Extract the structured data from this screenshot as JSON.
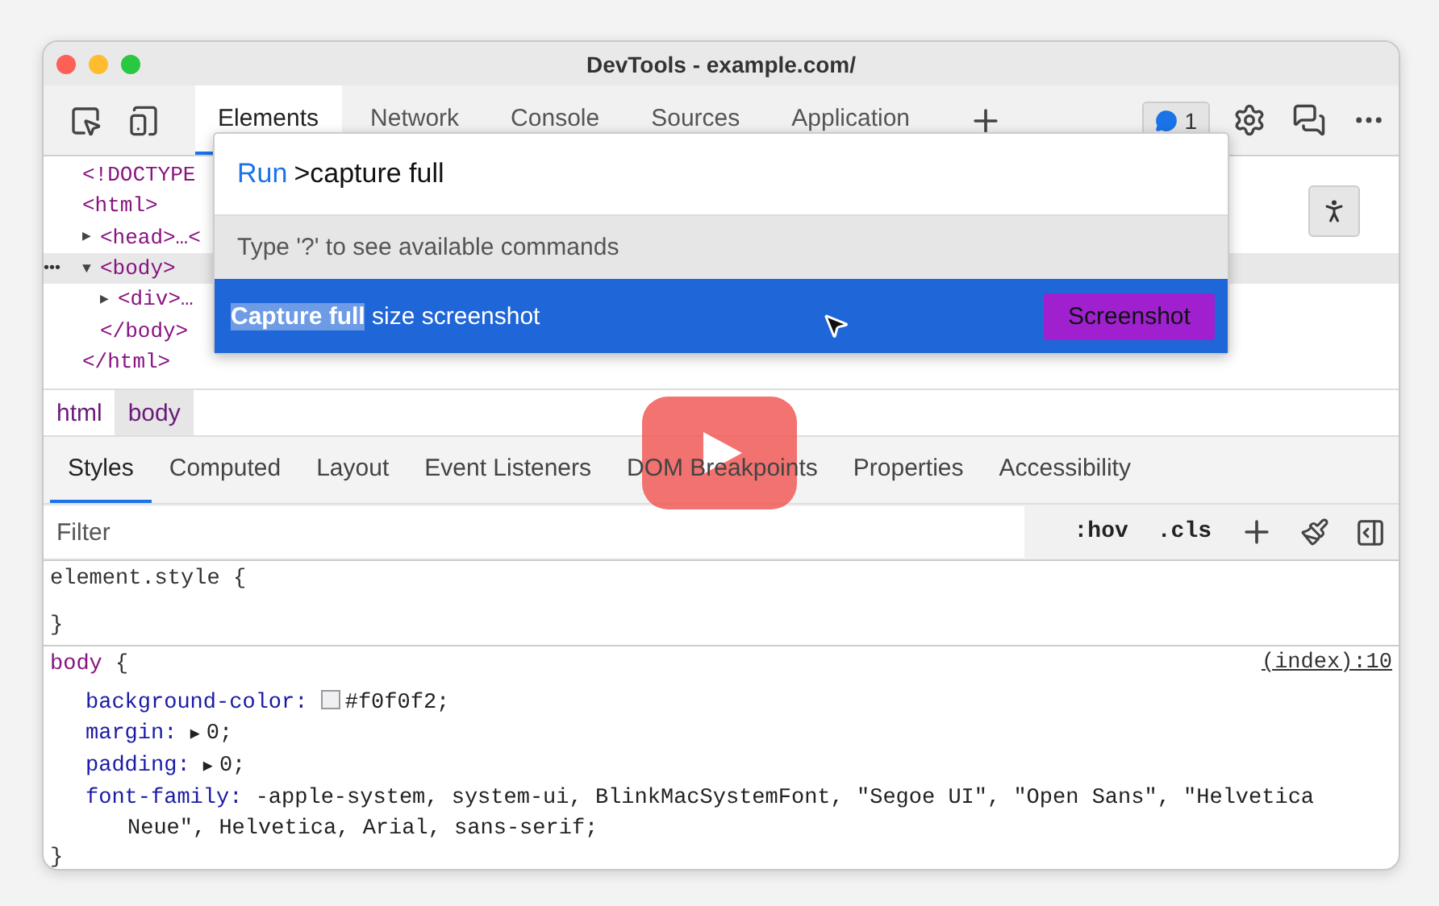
{
  "window": {
    "title": "DevTools - example.com/"
  },
  "toolbar": {
    "tabs": [
      {
        "label": "Elements",
        "selected": true
      },
      {
        "label": "Network",
        "selected": false
      },
      {
        "label": "Console",
        "selected": false
      },
      {
        "label": "Sources",
        "selected": false
      },
      {
        "label": "Application",
        "selected": false
      }
    ],
    "issues_count": "1"
  },
  "dom_tree": [
    {
      "text": "<!DOCTYPE",
      "selected": false
    },
    {
      "text": "<html>",
      "selected": false,
      "closing": "</html>",
      "children": [
        {
          "text": "<head>…<",
          "marker": "▶",
          "selected": false
        },
        {
          "text": "<body>",
          "marker": "▼",
          "selected": true,
          "dots": "•••",
          "closing": "</body>",
          "children": [
            {
              "text": "<div>…",
              "marker": "▶",
              "selected": false
            }
          ]
        }
      ]
    }
  ],
  "command_menu": {
    "prompt": "Run",
    "query": ">capture full",
    "hint": "Type '?' to see available commands",
    "results": [
      {
        "match": "Capture full",
        "rest": " size screenshot",
        "selected": true,
        "action": "Screenshot"
      }
    ]
  },
  "breadcrumbs": [
    {
      "label": "html",
      "selected": false
    },
    {
      "label": "body",
      "selected": true
    }
  ],
  "style_tabs": [
    {
      "label": "Styles",
      "selected": true
    },
    {
      "label": "Computed",
      "selected": false
    },
    {
      "label": "Layout",
      "selected": false
    },
    {
      "label": "Event Listeners",
      "selected": false
    },
    {
      "label": "DOM Breakpoints",
      "selected": false
    },
    {
      "label": "Properties",
      "selected": false
    },
    {
      "label": "Accessibility",
      "selected": false
    }
  ],
  "filter": {
    "placeholder": "Filter",
    "buttons": [
      ":hov",
      ".cls"
    ]
  },
  "rules": [
    {
      "selector": "element.style",
      "open": "{",
      "close": "}"
    },
    {
      "selector": "body",
      "open": "{",
      "close": "}",
      "source": "(index):10",
      "declarations": [
        {
          "property": "background-color:",
          "value": "#f0f0f2;",
          "color": "#f0f0f2"
        },
        {
          "property": "margin:",
          "value": "0;",
          "expander": "▶"
        },
        {
          "property": "padding:",
          "value": "0;",
          "expander": "▶"
        },
        {
          "property": "font-family:",
          "value": "-apple-system, system-ui, BlinkMacSystemFont, \"Segoe UI\", \"Open Sans\", \"Helvetica Neue\", Helvetica, Arial, sans-serif;"
        }
      ]
    }
  ],
  "video_overlay": {
    "kind": "play-button"
  }
}
